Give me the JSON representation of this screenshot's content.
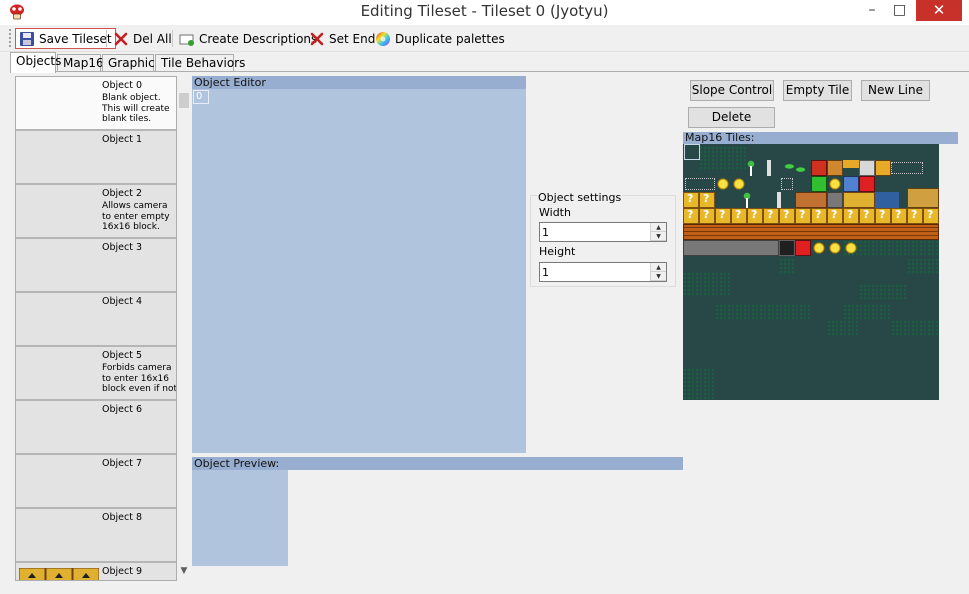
{
  "window": {
    "title": "Editing Tileset - Tileset 0 (Jyotyu)",
    "minimize_glyph": "–",
    "maximize_glyph": "□",
    "close_glyph": "✕"
  },
  "toolbar": {
    "save_tileset": "Save Tileset",
    "del_all": "Del All",
    "create_descriptions": "Create Descriptions",
    "set_end": "Set End",
    "duplicate_palettes": "Duplicate palettes"
  },
  "tabs": [
    "Objects",
    "Map16",
    "Graphics",
    "Tile Behaviors"
  ],
  "objects": [
    {
      "title": "Object 0",
      "desc": "Blank object. This will create blank tiles."
    },
    {
      "title": "Object 1",
      "desc": ""
    },
    {
      "title": "Object 2",
      "desc": "Allows camera to enter empty 16x16 block."
    },
    {
      "title": "Object 3",
      "desc": ""
    },
    {
      "title": "Object 4",
      "desc": ""
    },
    {
      "title": "Object 5",
      "desc": "Forbids camera to enter 16x16 block even if not"
    },
    {
      "title": "Object 6",
      "desc": ""
    },
    {
      "title": "Object 7",
      "desc": ""
    },
    {
      "title": "Object 8",
      "desc": ""
    },
    {
      "title": "Object 9",
      "desc": ""
    }
  ],
  "editor": {
    "header": "Object Editor",
    "cell_value": "0",
    "preview_header": "Object Preview:"
  },
  "settings": {
    "legend": "Object settings",
    "width_label": "Width",
    "width_value": "1",
    "height_label": "Height",
    "height_value": "1"
  },
  "buttons": {
    "slope_control": "Slope Control",
    "empty_tile": "Empty Tile",
    "new_line": "New Line",
    "delete": "Delete"
  },
  "map16": {
    "header": "Map16 Tiles:"
  },
  "colors": {
    "panel_blue": "#b0c4de",
    "header_blue": "#98aed0",
    "close_red": "#c7312a",
    "map16_bg": "#284848"
  }
}
